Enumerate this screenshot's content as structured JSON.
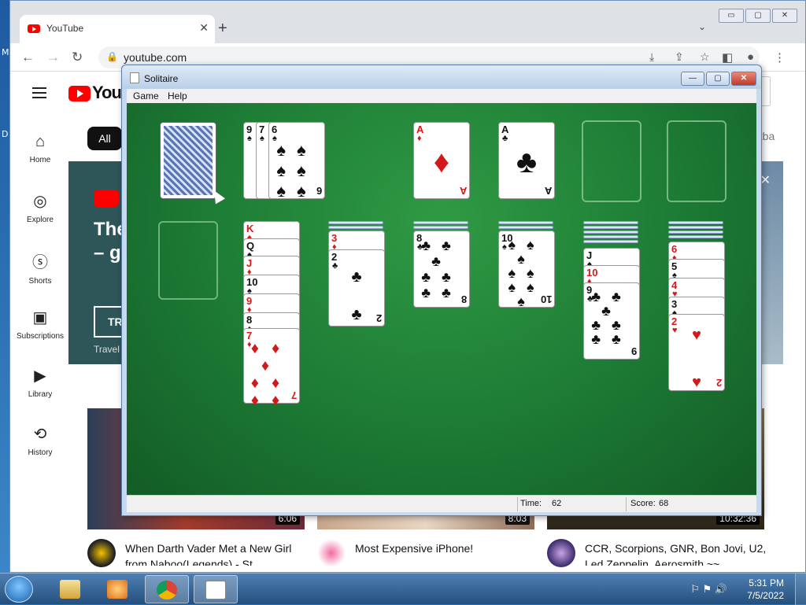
{
  "desktop": {
    "left_letters": [
      "M",
      "D"
    ]
  },
  "chrome": {
    "tab_title": "YouTube",
    "tab_close": "✕",
    "new_tab": "+",
    "tab_dropdown": "⌄",
    "window_buttons": {
      "minimize": "▭",
      "maximize": "▢",
      "close": "✕"
    },
    "url": "youtube.com"
  },
  "youtube": {
    "brand_partial": "YouTu",
    "sidebar": [
      {
        "label": "Home",
        "icon": "⌂"
      },
      {
        "label": "Explore",
        "icon": "◎"
      },
      {
        "label": "Shorts",
        "icon": "ⓢ"
      },
      {
        "label": "Subscriptions",
        "icon": "▣"
      },
      {
        "label": "Library",
        "icon": "▶"
      },
      {
        "label": "History",
        "icon": "⟲"
      }
    ],
    "chip_all": "All",
    "chip_right_partial": "etba",
    "banner": {
      "title_line1": "The",
      "title_line2": "– gc",
      "button_partial": "TR",
      "sub": "Travel",
      "close": "✕"
    },
    "videos": [
      {
        "title": "When Darth Vader Met a New Girl from Naboo(Legends) - St",
        "duration": "6:06"
      },
      {
        "title": "Most Expensive iPhone!",
        "duration": "8:03"
      },
      {
        "title": "CCR, Scorpions, GNR, Bon Jovi, U2, Led Zeppelin, Aerosmith ~~",
        "duration": "10:32:36"
      }
    ]
  },
  "solitaire": {
    "title": "Solitaire",
    "menu": {
      "game": "Game",
      "help": "Help"
    },
    "window_buttons": {
      "minimize": "—",
      "maximize": "▢",
      "close": "✕"
    },
    "waste": [
      {
        "rank": "9",
        "suit": "♠",
        "color": "blk"
      },
      {
        "rank": "7",
        "suit": "♠",
        "color": "blk"
      },
      {
        "rank": "6",
        "suit": "♠",
        "color": "blk"
      }
    ],
    "foundations": [
      {
        "rank": "A",
        "suit": "♦",
        "color": "red"
      },
      {
        "rank": "A",
        "suit": "♣",
        "color": "blk"
      }
    ],
    "tableau": [
      {
        "cards": []
      },
      {
        "cards": [
          {
            "rank": "K",
            "suit": "♠",
            "color": "red"
          },
          {
            "rank": "Q",
            "suit": "♠",
            "color": "blk"
          },
          {
            "rank": "J",
            "suit": "♦",
            "color": "red"
          },
          {
            "rank": "10",
            "suit": "♠",
            "color": "blk"
          },
          {
            "rank": "9",
            "suit": "♦",
            "color": "red"
          },
          {
            "rank": "8",
            "suit": "♠",
            "color": "blk"
          },
          {
            "rank": "7",
            "suit": "♦",
            "color": "red"
          }
        ]
      },
      {
        "cards": [
          {
            "rank": "3",
            "suit": "♦",
            "color": "red"
          },
          {
            "rank": "2",
            "suit": "♣",
            "color": "blk"
          }
        ]
      },
      {
        "cards": [
          {
            "rank": "8",
            "suit": "♣",
            "color": "blk"
          }
        ]
      },
      {
        "cards": [
          {
            "rank": "10",
            "suit": "♠",
            "color": "blk"
          }
        ]
      },
      {
        "cards": [
          {
            "rank": "J",
            "suit": "♠",
            "color": "blk"
          },
          {
            "rank": "10",
            "suit": "♦",
            "color": "red"
          },
          {
            "rank": "9",
            "suit": "♣",
            "color": "blk"
          }
        ]
      },
      {
        "cards": [
          {
            "rank": "6",
            "suit": "♦",
            "color": "red"
          },
          {
            "rank": "5",
            "suit": "♠",
            "color": "blk"
          },
          {
            "rank": "4",
            "suit": "♥",
            "color": "red"
          },
          {
            "rank": "3",
            "suit": "♠",
            "color": "blk"
          },
          {
            "rank": "2",
            "suit": "♥",
            "color": "red"
          }
        ]
      }
    ],
    "status": {
      "time_label": "Time:",
      "time_value": "62",
      "score_label": "Score:",
      "score_value": "68"
    }
  },
  "taskbar": {
    "clock_time": "5:31 PM",
    "clock_date": "7/5/2022",
    "tray_icons": "⚐ ⚑ 🔊"
  }
}
